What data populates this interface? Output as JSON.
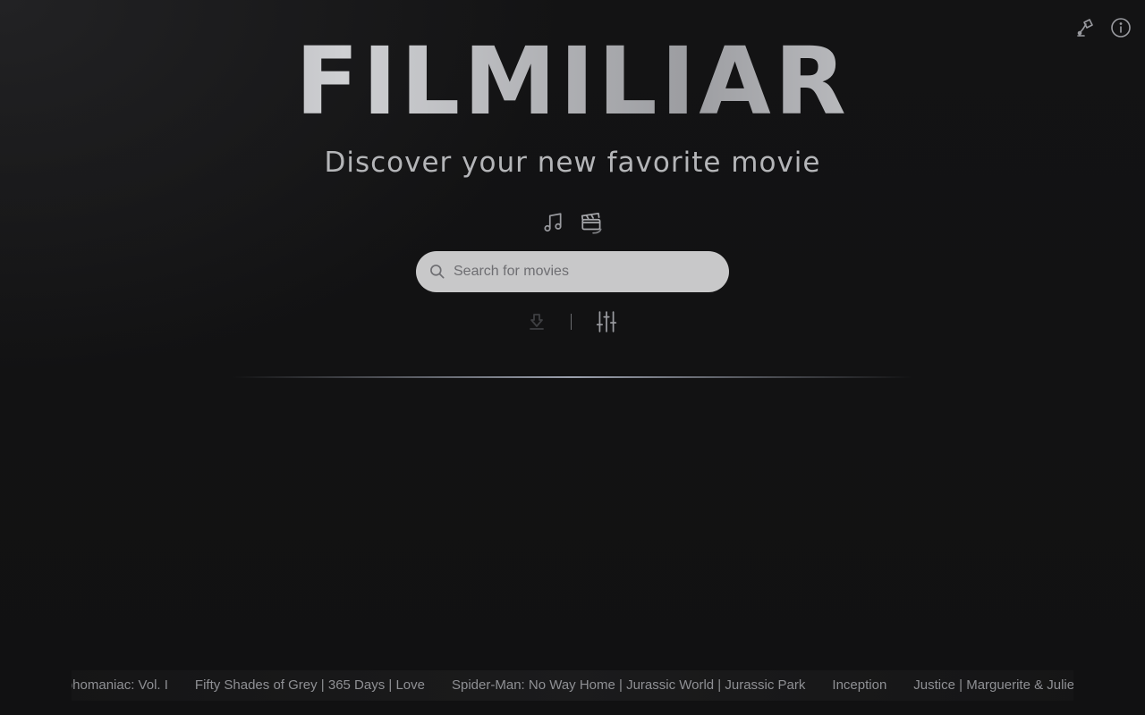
{
  "app": {
    "logo": "FILMILIAR",
    "tagline": "Discover your new favorite movie"
  },
  "top_icons": [
    {
      "name": "theme-lamp-icon"
    },
    {
      "name": "info-icon"
    }
  ],
  "modes": [
    {
      "name": "music-mode",
      "icon": "music-note-icon"
    },
    {
      "name": "movie-mode",
      "icon": "clapperboard-icon",
      "active": true
    }
  ],
  "search": {
    "placeholder": "Search for movies",
    "value": ""
  },
  "tools": [
    {
      "name": "download-icon"
    },
    {
      "name": "sliders-icon"
    }
  ],
  "ticker": {
    "items": [
      "Nymphomaniac: Vol. I",
      "Fifty Shades of Grey | 365 Days | Love",
      "Spider-Man: No Way Home | Jurassic World | Jurassic Park",
      "Inception",
      "Justice | Marguerite & Julien"
    ]
  },
  "colors": {
    "background": "#121213",
    "text_muted": "#8f9094",
    "search_bg": "#c8c8c9",
    "icon": "#9a9ba0"
  }
}
